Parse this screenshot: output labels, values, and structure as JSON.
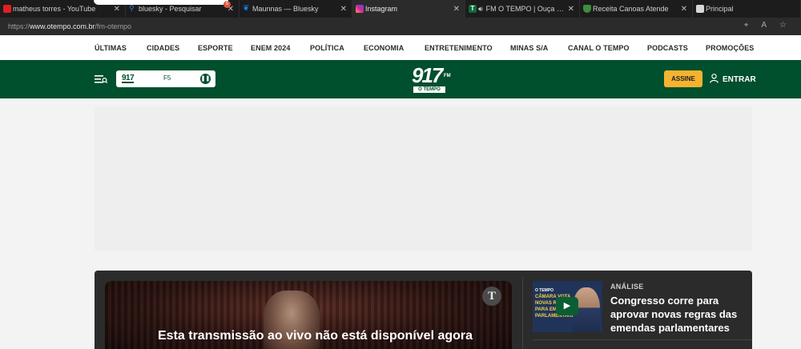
{
  "browser": {
    "tabs": [
      {
        "title": "matheus torres - YouTube",
        "favicon": "youtube-icon",
        "color": "#e02020"
      },
      {
        "title": "bluesky - Pesquisar",
        "favicon": "search-icon",
        "color": "#2f7de1"
      },
      {
        "title": "Maunnas — Bluesky",
        "favicon": "butterfly-icon",
        "color": "#1185fe"
      },
      {
        "title": "Instagram",
        "favicon": "instagram-icon",
        "color": "#d6249f"
      },
      {
        "title": "FM O TEMPO | Ouça as m",
        "favicon": "otempo-t-icon",
        "color": "#0d6b3a"
      },
      {
        "title": "Receita Canoas Atende",
        "favicon": "crest-icon",
        "color": "#3e8e3e"
      },
      {
        "title": "Principal",
        "favicon": "page-icon",
        "color": "#cccccc"
      }
    ],
    "popup_badge": "5",
    "url_prefix": "https://",
    "url_host": "www.otempo.com.br",
    "url_path": "/fm-otempo"
  },
  "nav": {
    "items": [
      "ÚLTIMAS",
      "CIDADES",
      "ESPORTE",
      "ENEM 2024",
      "POLÍTICA",
      "ECONOMIA",
      "ENTRETENIMENTO",
      "MINAS S/A",
      "CANAL O TEMPO",
      "PODCASTS",
      "PROMOÇÕES"
    ]
  },
  "header": {
    "player_logo": "917",
    "player_station": "F5",
    "brand_number": "917",
    "brand_fm": "FM",
    "brand_sub": "O TEMPO",
    "subscribe_label": "ASSINE",
    "login_label": "ENTRAR",
    "accent": "#f5b331",
    "green": "#004f2d"
  },
  "live": {
    "badge": "T",
    "offline_message": "Esta transmissão ao vivo não está disponível agora"
  },
  "sidebar": {
    "thumb_logo": "O TEMPO",
    "thumb_lines": [
      "CÂMARA VOTA",
      "NOVAS REGR",
      "PARA EMEN",
      "PARLAMENTARES"
    ],
    "tag": "ANÁLISE",
    "headline": "Congresso corre para aprovar novas regras das emendas parlamentares"
  }
}
